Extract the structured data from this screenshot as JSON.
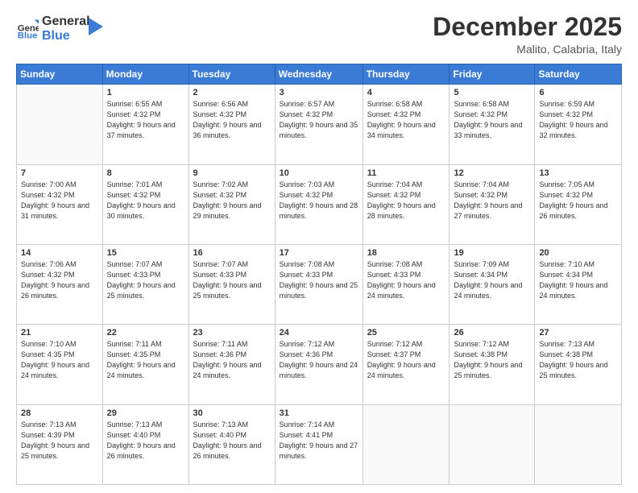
{
  "header": {
    "logo_general": "General",
    "logo_blue": "Blue",
    "month_title": "December 2025",
    "location": "Malito, Calabria, Italy"
  },
  "weekdays": [
    "Sunday",
    "Monday",
    "Tuesday",
    "Wednesday",
    "Thursday",
    "Friday",
    "Saturday"
  ],
  "weeks": [
    [
      {
        "day": "",
        "sunrise": "",
        "sunset": "",
        "daylight": ""
      },
      {
        "day": "1",
        "sunrise": "Sunrise: 6:55 AM",
        "sunset": "Sunset: 4:32 PM",
        "daylight": "Daylight: 9 hours and 37 minutes."
      },
      {
        "day": "2",
        "sunrise": "Sunrise: 6:56 AM",
        "sunset": "Sunset: 4:32 PM",
        "daylight": "Daylight: 9 hours and 36 minutes."
      },
      {
        "day": "3",
        "sunrise": "Sunrise: 6:57 AM",
        "sunset": "Sunset: 4:32 PM",
        "daylight": "Daylight: 9 hours and 35 minutes."
      },
      {
        "day": "4",
        "sunrise": "Sunrise: 6:58 AM",
        "sunset": "Sunset: 4:32 PM",
        "daylight": "Daylight: 9 hours and 34 minutes."
      },
      {
        "day": "5",
        "sunrise": "Sunrise: 6:58 AM",
        "sunset": "Sunset: 4:32 PM",
        "daylight": "Daylight: 9 hours and 33 minutes."
      },
      {
        "day": "6",
        "sunrise": "Sunrise: 6:59 AM",
        "sunset": "Sunset: 4:32 PM",
        "daylight": "Daylight: 9 hours and 32 minutes."
      }
    ],
    [
      {
        "day": "7",
        "sunrise": "Sunrise: 7:00 AM",
        "sunset": "Sunset: 4:32 PM",
        "daylight": "Daylight: 9 hours and 31 minutes."
      },
      {
        "day": "8",
        "sunrise": "Sunrise: 7:01 AM",
        "sunset": "Sunset: 4:32 PM",
        "daylight": "Daylight: 9 hours and 30 minutes."
      },
      {
        "day": "9",
        "sunrise": "Sunrise: 7:02 AM",
        "sunset": "Sunset: 4:32 PM",
        "daylight": "Daylight: 9 hours and 29 minutes."
      },
      {
        "day": "10",
        "sunrise": "Sunrise: 7:03 AM",
        "sunset": "Sunset: 4:32 PM",
        "daylight": "Daylight: 9 hours and 28 minutes."
      },
      {
        "day": "11",
        "sunrise": "Sunrise: 7:04 AM",
        "sunset": "Sunset: 4:32 PM",
        "daylight": "Daylight: 9 hours and 28 minutes."
      },
      {
        "day": "12",
        "sunrise": "Sunrise: 7:04 AM",
        "sunset": "Sunset: 4:32 PM",
        "daylight": "Daylight: 9 hours and 27 minutes."
      },
      {
        "day": "13",
        "sunrise": "Sunrise: 7:05 AM",
        "sunset": "Sunset: 4:32 PM",
        "daylight": "Daylight: 9 hours and 26 minutes."
      }
    ],
    [
      {
        "day": "14",
        "sunrise": "Sunrise: 7:06 AM",
        "sunset": "Sunset: 4:32 PM",
        "daylight": "Daylight: 9 hours and 26 minutes."
      },
      {
        "day": "15",
        "sunrise": "Sunrise: 7:07 AM",
        "sunset": "Sunset: 4:33 PM",
        "daylight": "Daylight: 9 hours and 25 minutes."
      },
      {
        "day": "16",
        "sunrise": "Sunrise: 7:07 AM",
        "sunset": "Sunset: 4:33 PM",
        "daylight": "Daylight: 9 hours and 25 minutes."
      },
      {
        "day": "17",
        "sunrise": "Sunrise: 7:08 AM",
        "sunset": "Sunset: 4:33 PM",
        "daylight": "Daylight: 9 hours and 25 minutes."
      },
      {
        "day": "18",
        "sunrise": "Sunrise: 7:08 AM",
        "sunset": "Sunset: 4:33 PM",
        "daylight": "Daylight: 9 hours and 24 minutes."
      },
      {
        "day": "19",
        "sunrise": "Sunrise: 7:09 AM",
        "sunset": "Sunset: 4:34 PM",
        "daylight": "Daylight: 9 hours and 24 minutes."
      },
      {
        "day": "20",
        "sunrise": "Sunrise: 7:10 AM",
        "sunset": "Sunset: 4:34 PM",
        "daylight": "Daylight: 9 hours and 24 minutes."
      }
    ],
    [
      {
        "day": "21",
        "sunrise": "Sunrise: 7:10 AM",
        "sunset": "Sunset: 4:35 PM",
        "daylight": "Daylight: 9 hours and 24 minutes."
      },
      {
        "day": "22",
        "sunrise": "Sunrise: 7:11 AM",
        "sunset": "Sunset: 4:35 PM",
        "daylight": "Daylight: 9 hours and 24 minutes."
      },
      {
        "day": "23",
        "sunrise": "Sunrise: 7:11 AM",
        "sunset": "Sunset: 4:36 PM",
        "daylight": "Daylight: 9 hours and 24 minutes."
      },
      {
        "day": "24",
        "sunrise": "Sunrise: 7:12 AM",
        "sunset": "Sunset: 4:36 PM",
        "daylight": "Daylight: 9 hours and 24 minutes."
      },
      {
        "day": "25",
        "sunrise": "Sunrise: 7:12 AM",
        "sunset": "Sunset: 4:37 PM",
        "daylight": "Daylight: 9 hours and 24 minutes."
      },
      {
        "day": "26",
        "sunrise": "Sunrise: 7:12 AM",
        "sunset": "Sunset: 4:38 PM",
        "daylight": "Daylight: 9 hours and 25 minutes."
      },
      {
        "day": "27",
        "sunrise": "Sunrise: 7:13 AM",
        "sunset": "Sunset: 4:38 PM",
        "daylight": "Daylight: 9 hours and 25 minutes."
      }
    ],
    [
      {
        "day": "28",
        "sunrise": "Sunrise: 7:13 AM",
        "sunset": "Sunset: 4:39 PM",
        "daylight": "Daylight: 9 hours and 25 minutes."
      },
      {
        "day": "29",
        "sunrise": "Sunrise: 7:13 AM",
        "sunset": "Sunset: 4:40 PM",
        "daylight": "Daylight: 9 hours and 26 minutes."
      },
      {
        "day": "30",
        "sunrise": "Sunrise: 7:13 AM",
        "sunset": "Sunset: 4:40 PM",
        "daylight": "Daylight: 9 hours and 26 minutes."
      },
      {
        "day": "31",
        "sunrise": "Sunrise: 7:14 AM",
        "sunset": "Sunset: 4:41 PM",
        "daylight": "Daylight: 9 hours and 27 minutes."
      },
      {
        "day": "",
        "sunrise": "",
        "sunset": "",
        "daylight": ""
      },
      {
        "day": "",
        "sunrise": "",
        "sunset": "",
        "daylight": ""
      },
      {
        "day": "",
        "sunrise": "",
        "sunset": "",
        "daylight": ""
      }
    ]
  ]
}
